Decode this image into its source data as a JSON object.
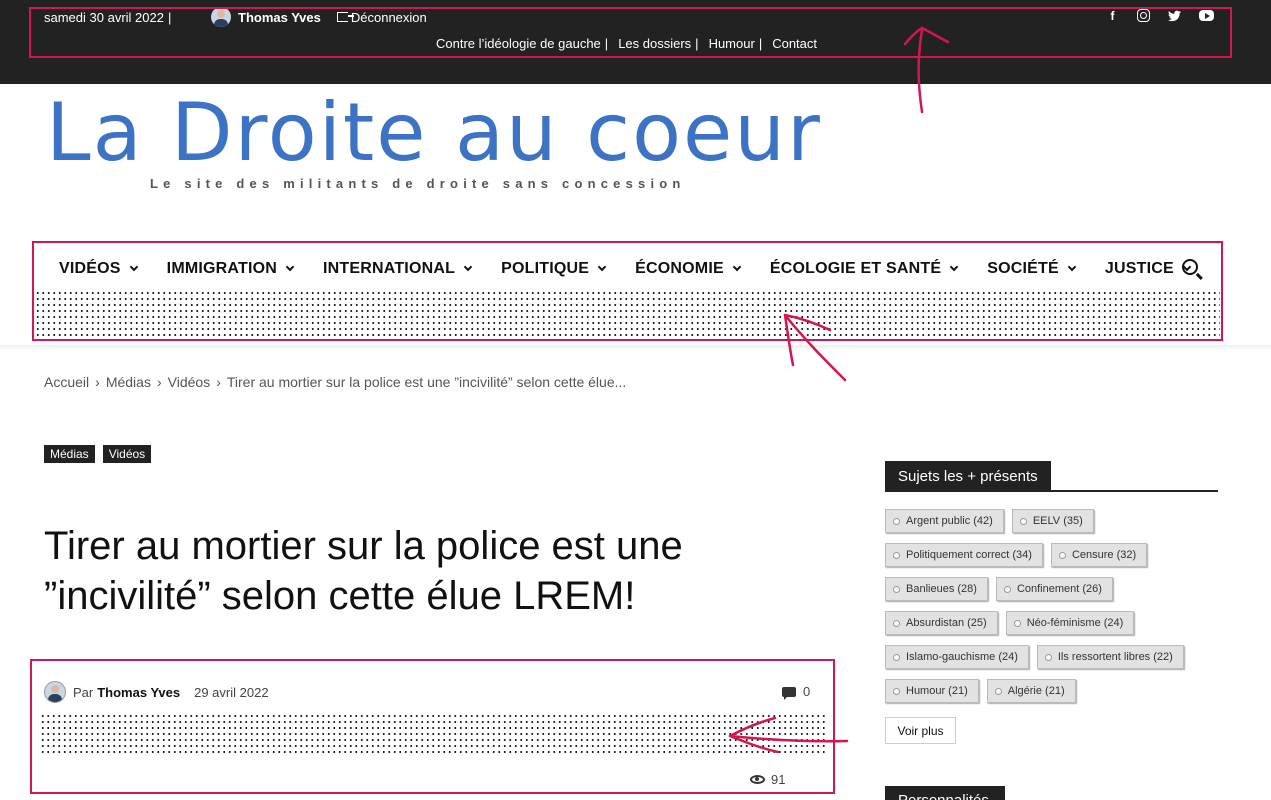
{
  "topbar": {
    "date": "samedi 30 avril 2022",
    "separator": "|",
    "user_name": "Thomas Yves",
    "logout_label": "Déconnexion",
    "menu": [
      {
        "label": "Contre l’idéologie de gauche",
        "sep": "|"
      },
      {
        "label": "Les dossiers",
        "sep": "|"
      },
      {
        "label": "Humour",
        "sep": "|"
      },
      {
        "label": "Contact",
        "sep": ""
      }
    ],
    "social_icons": [
      "facebook-icon",
      "instagram-icon",
      "twitter-icon",
      "youtube-icon"
    ]
  },
  "site": {
    "logo_text": "La Droite au coeur",
    "tagline": "Le site des militants de droite sans concession",
    "logo_color": "#3d73c4"
  },
  "mainnav": {
    "items": [
      "VIDÉOS",
      "IMMIGRATION",
      "INTERNATIONAL",
      "POLITIQUE",
      "ÉCONOMIE",
      "ÉCOLOGIE ET SANTÉ",
      "SOCIÉTÉ",
      "JUSTICE"
    ]
  },
  "breadcrumb": {
    "items": [
      "Accueil",
      "Médias",
      "Vidéos",
      "Tirer au mortier sur la police est une ”incivilité” selon cette élue..."
    ],
    "sep": "›"
  },
  "article": {
    "categories": [
      "Médias",
      "Vidéos"
    ],
    "title": "Tirer au mortier sur la police est une ”incivilité” selon cette élue LREM!",
    "by_label": "Par",
    "author": "Thomas Yves",
    "date": "29 avril 2022",
    "comments_count": "0",
    "views_count": "91"
  },
  "sidebar": {
    "tags_title": "Sujets les + présents",
    "tags": [
      "Argent public (42)",
      "EELV (35)",
      "Politiquement correct (34)",
      "Censure (32)",
      "Banlieues (28)",
      "Confinement (26)",
      "Absurdistan (25)",
      "Néo-féminisme (24)",
      "Islamo-gauchisme (24)",
      "Ils ressortent libres (22)",
      "Humour (21)",
      "Algérie (21)"
    ],
    "voir_plus": "Voir plus",
    "next_title": "Personnalités"
  },
  "colors": {
    "topbar_bg": "#222222",
    "annotation": "#d4164f",
    "category_bg": "#222222"
  }
}
